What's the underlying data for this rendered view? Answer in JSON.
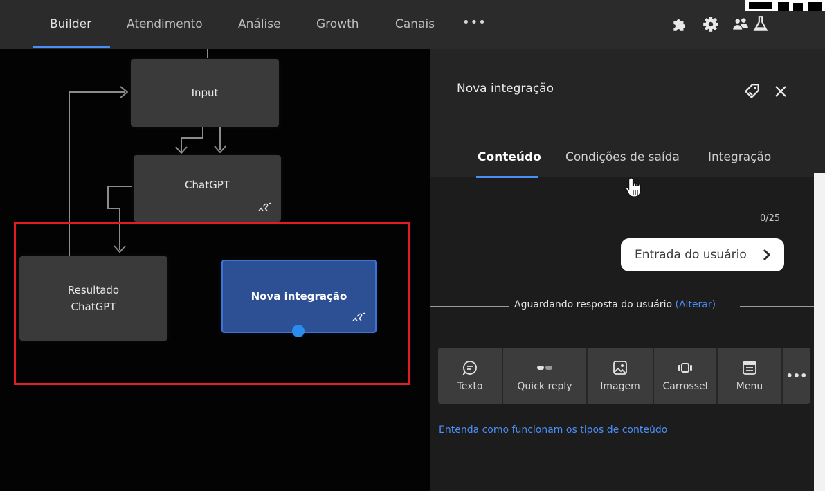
{
  "nav": {
    "items": [
      "Builder",
      "Atendimento",
      "Análise",
      "Growth",
      "Canais"
    ],
    "more": "•••",
    "icons": [
      "puzzle-icon",
      "gear-icon",
      "users-icon",
      "flask-icon"
    ],
    "accent": "#4a8ff7"
  },
  "canvas": {
    "nodes": {
      "input": "Input",
      "chatgpt": "ChatGPT",
      "resultado_line1": "Resultado",
      "resultado_line2": "ChatGPT",
      "nova": "Nova integração"
    },
    "selection_color": "#e31b23"
  },
  "panel": {
    "title": "Nova integração",
    "tabs": [
      "Conteúdo",
      "Condições de saída",
      "Integração"
    ],
    "counter": "0/25",
    "user_entry": "Entrada do usuário",
    "waiting_text": "Aguardando resposta do usuário",
    "waiting_link": "(Alterar)",
    "tools": [
      "Texto",
      "Quick reply",
      "Imagem",
      "Carrossel",
      "Menu"
    ],
    "tools_more": "•••",
    "help_link": "Entenda como funcionam os tipos de conteúdo"
  }
}
